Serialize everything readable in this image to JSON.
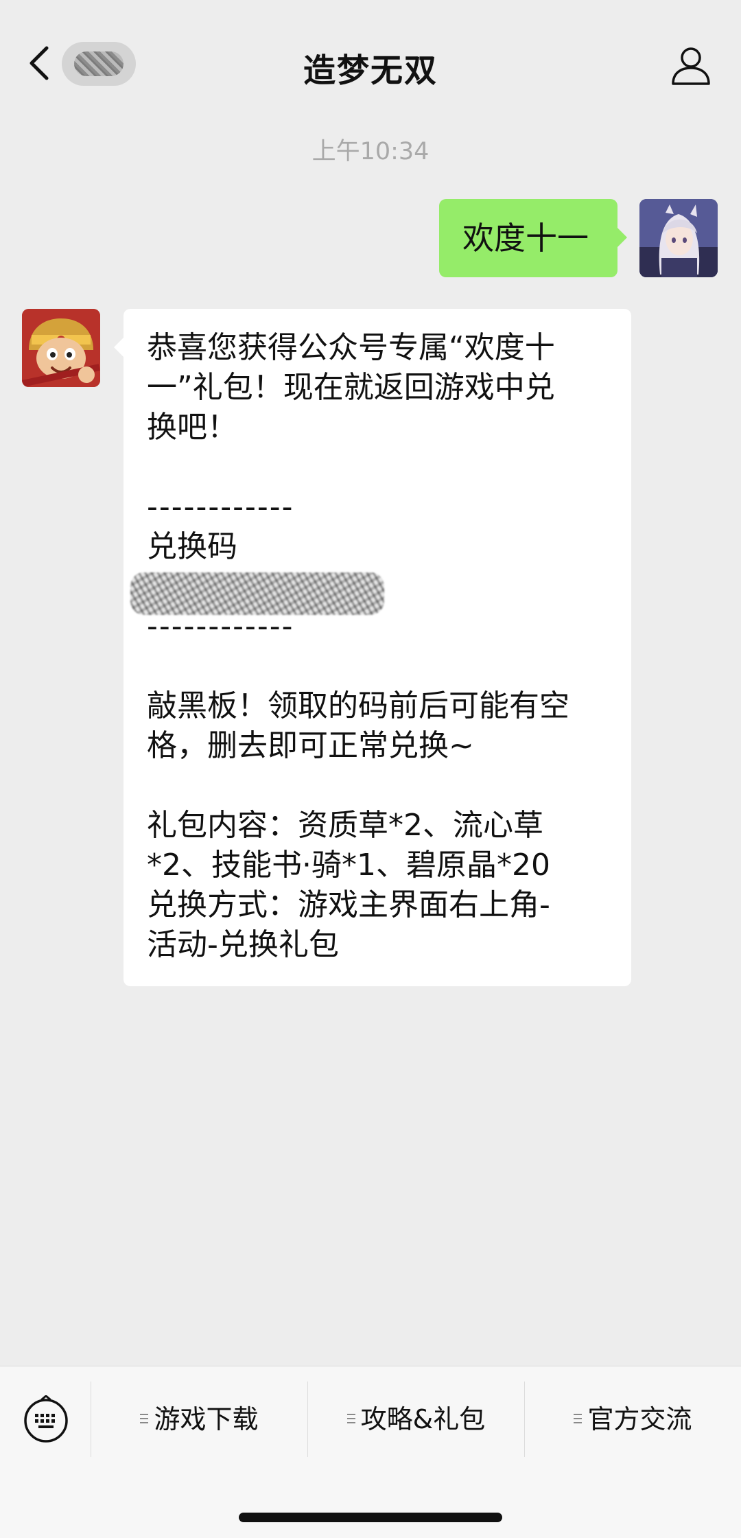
{
  "header": {
    "title": "造梦无双",
    "back_icon": "chevron-left-icon",
    "profile_icon": "person-icon"
  },
  "chat": {
    "timestamp": "上午10:34",
    "outgoing": {
      "text": "欢度十一"
    },
    "incoming": {
      "lines": [
        "恭喜您获得公众号专属“欢度十",
        "一”礼包！现在就返回游戏中兑",
        "换吧！",
        "",
        "------------",
        "兑换码",
        "",
        "------------",
        "",
        "敲黑板！领取的码前后可能有空",
        "格，删去即可正常兑换~",
        "",
        "礼包内容：资质草*2、流心草",
        "*2、技能书·骑*1、碧原晶*20",
        "兑换方式：游戏主界面右上角-",
        "活动-兑换礼包"
      ]
    }
  },
  "bottom_menu": {
    "keyboard_icon": "keyboard-icon",
    "items": [
      {
        "label": "游戏下载"
      },
      {
        "label": "攻略&礼包"
      },
      {
        "label": "官方交流"
      }
    ]
  },
  "colors": {
    "background": "#ededed",
    "outgoing_bubble": "#95ec69",
    "incoming_bubble": "#ffffff",
    "timestamp": "#a9a9a9"
  }
}
